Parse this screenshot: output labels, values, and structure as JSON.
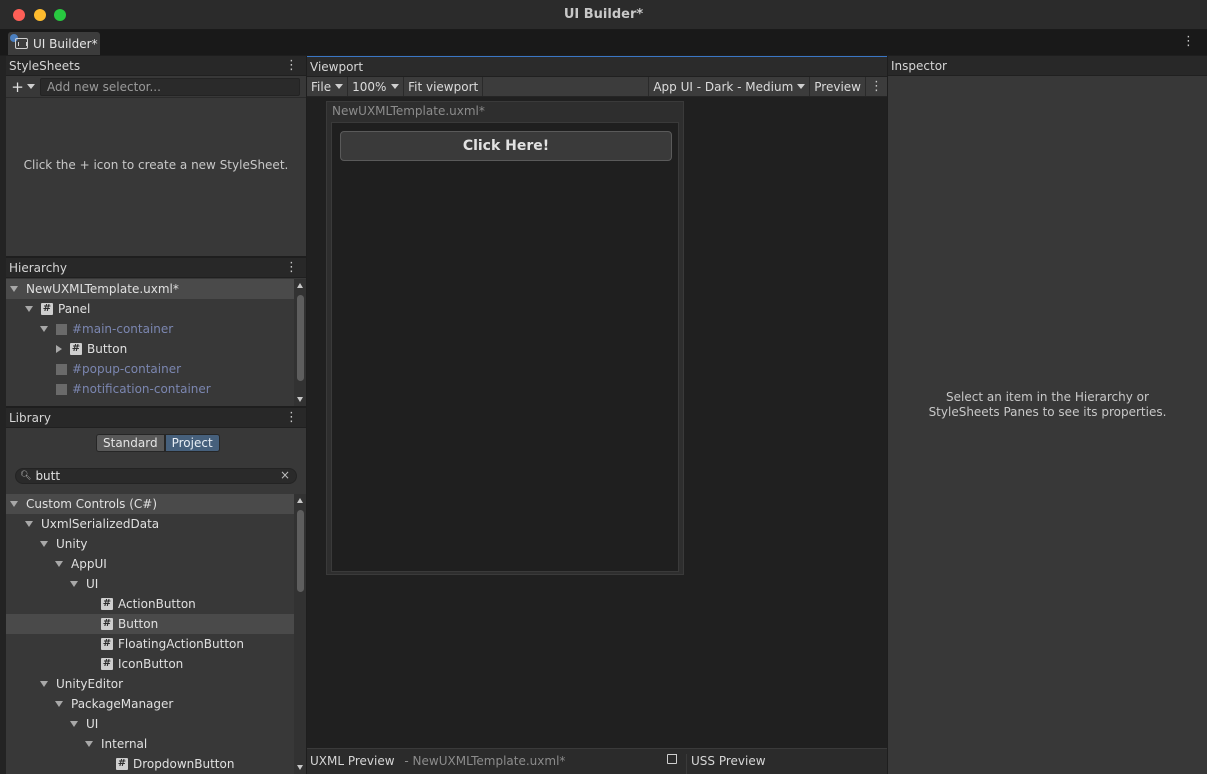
{
  "window": {
    "title": "UI Builder*"
  },
  "tab": {
    "label": "UI Builder*"
  },
  "stylesheets": {
    "title": "StyleSheets",
    "selector_placeholder": "Add new selector...",
    "empty_message": "Click the + icon to create a new StyleSheet."
  },
  "hierarchy": {
    "title": "Hierarchy",
    "items": [
      {
        "label": "NewUXMLTemplate.uxml*"
      },
      {
        "label": "Panel"
      },
      {
        "label": "#main-container"
      },
      {
        "label": "Button"
      },
      {
        "label": "#popup-container"
      },
      {
        "label": "#notification-container"
      }
    ]
  },
  "library": {
    "title": "Library",
    "tabs": {
      "standard": "Standard",
      "project": "Project"
    },
    "search_value": "butt",
    "items": [
      {
        "label": "Custom Controls (C#)"
      },
      {
        "label": "UxmlSerializedData"
      },
      {
        "label": "Unity"
      },
      {
        "label": "AppUI"
      },
      {
        "label": "UI"
      },
      {
        "label": "ActionButton"
      },
      {
        "label": "Button"
      },
      {
        "label": "FloatingActionButton"
      },
      {
        "label": "IconButton"
      },
      {
        "label": "UnityEditor"
      },
      {
        "label": "PackageManager"
      },
      {
        "label": "UI"
      },
      {
        "label": "Internal"
      },
      {
        "label": "DropdownButton"
      }
    ]
  },
  "viewport": {
    "title": "Viewport",
    "toolbar": {
      "file": "File",
      "zoom": "100%",
      "fit": "Fit viewport",
      "theme": "App UI - Dark - Medium",
      "preview": "Preview"
    },
    "canvas_title": "NewUXMLTemplate.uxml*",
    "canvas_button": "Click Here!",
    "uxml_preview_label": "UXML Preview",
    "uxml_preview_file": "- NewUXMLTemplate.uxml*",
    "uss_preview_label": "USS Preview"
  },
  "inspector": {
    "title": "Inspector",
    "message_line1": "Select an item in the Hierarchy or",
    "message_line2": "StyleSheets Panes to see its properties."
  },
  "colors": {
    "accent": "#3a76c4",
    "selected_tab": "#46607c",
    "close": "#fe5f57",
    "minimize": "#febc2e",
    "maximize": "#28c840"
  }
}
